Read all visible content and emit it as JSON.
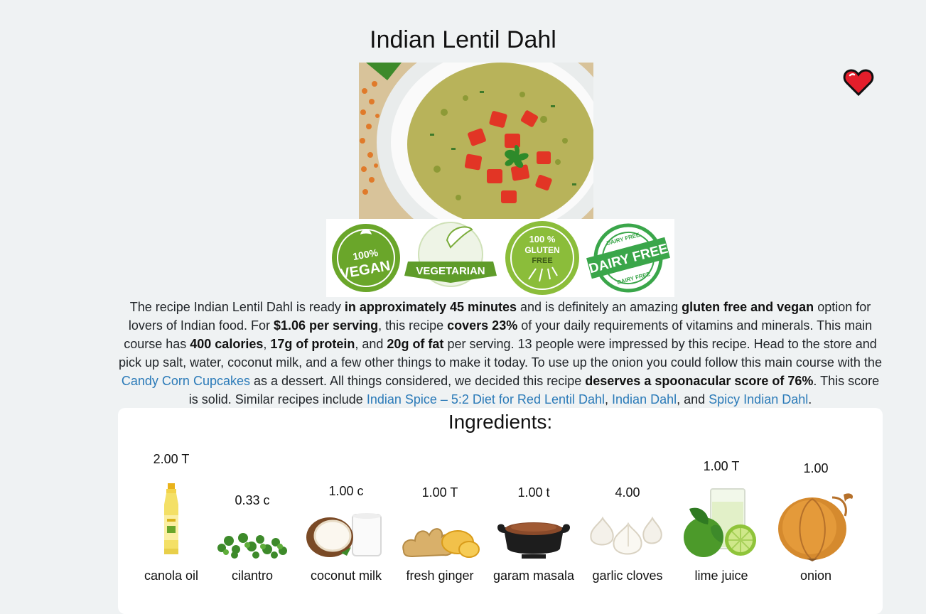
{
  "recipe": {
    "title": "Indian Lentil Dahl",
    "favorite_icon": "heart-icon",
    "badges": [
      {
        "icon": "vegan-badge",
        "text": "100% VEGAN"
      },
      {
        "icon": "vegetarian-badge",
        "text": "VEGETARIAN"
      },
      {
        "icon": "gluten-free-badge",
        "text": "100% GLUTEN FREE"
      },
      {
        "icon": "dairy-free-badge",
        "text": "DAIRY FREE"
      }
    ]
  },
  "summary": {
    "p1": "The recipe Indian Lentil Dahl is ready ",
    "b1": "in approximately 45 minutes",
    "p2": " and is definitely an amazing ",
    "b2": "gluten free and vegan",
    "p3": " option for lovers of Indian food. For ",
    "b3": "$1.06 per serving",
    "p4": ", this recipe ",
    "b4": "covers 23%",
    "p5": " of your daily requirements of vitamins and minerals. This main course has ",
    "b5": "400 calories",
    "p6": ", ",
    "b6": "17g of protein",
    "p7": ", and ",
    "b7": "20g of fat",
    "p8": " per serving. 13 people were impressed by this recipe. Head to the store and pick up salt, water, coconut milk, and a few other things to make it today. To use up the onion you could follow this main course with the ",
    "l1": "Candy Corn Cupcakes",
    "p9": " as a dessert. All things considered, we decided this recipe ",
    "b8": "deserves a spoonacular score of 76%",
    "p10": ". This score is solid. Similar recipes include ",
    "l2": "Indian Spice – 5:2 Diet for Red Lentil Dahl",
    "p11": ", ",
    "l3": "Indian Dahl",
    "p12": ", and ",
    "l4": "Spicy Indian Dahl",
    "p13": "."
  },
  "ingredients": {
    "heading": "Ingredients:",
    "items": [
      {
        "amount": "2.00 T",
        "name": "canola oil",
        "icon": "oil-bottle-icon"
      },
      {
        "amount": "0.33 c",
        "name": "cilantro",
        "icon": "cilantro-icon"
      },
      {
        "amount": "1.00 c",
        "name": "coconut milk",
        "icon": "coconut-icon"
      },
      {
        "amount": "1.00 T",
        "name": "fresh ginger",
        "icon": "ginger-icon"
      },
      {
        "amount": "1.00 t",
        "name": "garam masala",
        "icon": "spice-bowl-icon"
      },
      {
        "amount": "4.00",
        "name": "garlic cloves",
        "icon": "garlic-icon"
      },
      {
        "amount": "1.00 T",
        "name": "lime juice",
        "icon": "lime-icon"
      },
      {
        "amount": "1.00",
        "name": "onion",
        "icon": "onion-icon"
      }
    ]
  },
  "colors": {
    "background": "#eff2f3",
    "link": "#2a7ab8",
    "heart": "#e41e2b",
    "badge_green": "#6aa62a"
  }
}
